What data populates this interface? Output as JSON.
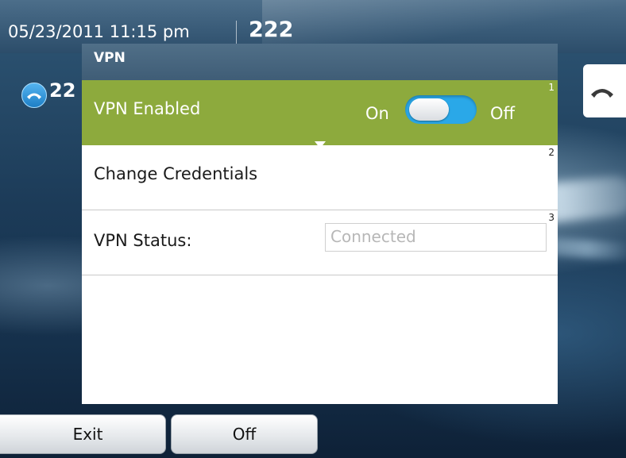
{
  "status_bar": {
    "datetime": "05/23/2011 11:15 pm",
    "extension": "222"
  },
  "line_button": {
    "label": "22"
  },
  "dialog": {
    "title": "VPN",
    "rows": [
      {
        "number": "1",
        "label": "VPN Enabled",
        "toggle_on_label": "On",
        "toggle_off_label": "Off",
        "toggle_state": "On"
      },
      {
        "number": "2",
        "label": "Change Credentials"
      },
      {
        "number": "3",
        "label": "VPN Status:",
        "value": "Connected"
      }
    ]
  },
  "softkeys": [
    {
      "label": "Exit"
    },
    {
      "label": "Off"
    }
  ],
  "colors": {
    "selected_row": "#8daa3d",
    "toggle_track": "#2aa8e8",
    "header": "#46647c",
    "accent_icon": "#2a95dc"
  },
  "icons": [
    "phone-handset-icon",
    "dropdown-caret-icon"
  ]
}
